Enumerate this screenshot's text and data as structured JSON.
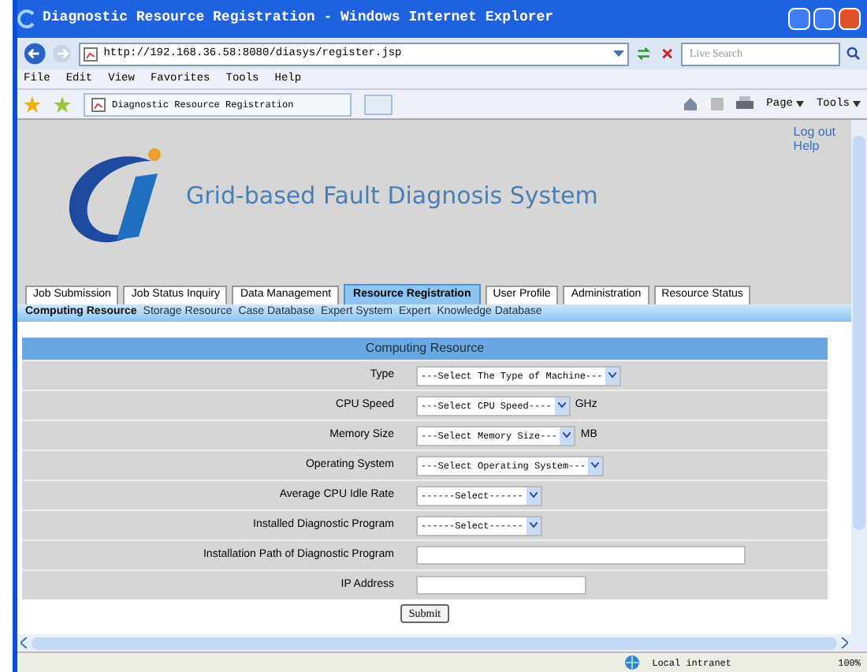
{
  "window": {
    "title": "Diagnostic Resource Registration - Windows Internet Explorer"
  },
  "address_bar": {
    "url": "http://192.168.36.58:8080/diasys/register.jsp"
  },
  "search": {
    "placeholder": "Live Search"
  },
  "menu": [
    "File",
    "Edit",
    "View",
    "Favorites",
    "Tools",
    "Help"
  ],
  "browser_tab": {
    "title": "Diagnostic Resource Registration"
  },
  "command_bar": [
    "Page",
    "Tools"
  ],
  "header": {
    "title": "Grid-based Fault Diagnosis System",
    "links": [
      "Log out",
      "Help"
    ]
  },
  "tabs": [
    {
      "label": "Job Submission",
      "selected": false
    },
    {
      "label": "Job Status Inquiry",
      "selected": false
    },
    {
      "label": "Data Management",
      "selected": false
    },
    {
      "label": "Resource Registration",
      "selected": true
    },
    {
      "label": "User Profile",
      "selected": false
    },
    {
      "label": "Administration",
      "selected": false
    },
    {
      "label": "Resource Status",
      "selected": false
    }
  ],
  "subnav": [
    {
      "label": "Computing Resource",
      "selected": true
    },
    {
      "label": "Storage Resource",
      "selected": false
    },
    {
      "label": "Case Database",
      "selected": false
    },
    {
      "label": "Expert System",
      "selected": false
    },
    {
      "label": "Expert",
      "selected": false
    },
    {
      "label": "Knowledge Database",
      "selected": false
    }
  ],
  "form": {
    "title": "Computing Resource",
    "fields": [
      {
        "label": "Type",
        "kind": "select",
        "value": "---Select The Type of Machine---"
      },
      {
        "label": "CPU Speed",
        "kind": "select",
        "value": "---Select CPU Speed----",
        "unit": "GHz"
      },
      {
        "label": "Memory Size",
        "kind": "select",
        "value": "---Select Memory Size---",
        "unit": "MB"
      },
      {
        "label": "Operating System",
        "kind": "select",
        "value": "---Select Operating System---"
      },
      {
        "label": "Average CPU Idle Rate",
        "kind": "select",
        "value": "------Select------"
      },
      {
        "label": "Installed Diagnostic Program",
        "kind": "select",
        "value": "------Select------"
      },
      {
        "label": "Installation Path of Diagnostic Program",
        "kind": "long_text"
      },
      {
        "label": "IP Address",
        "kind": "text"
      }
    ],
    "submit": "Submit"
  },
  "status_bar": {
    "zone": "Local intranet",
    "zoom": "100%"
  }
}
